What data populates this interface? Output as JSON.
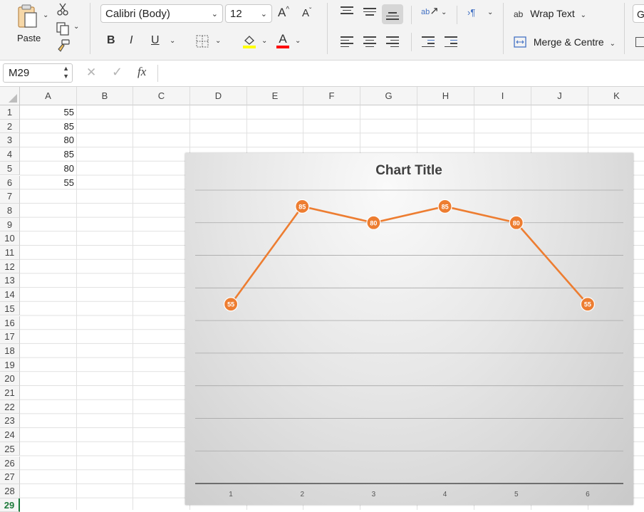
{
  "ribbon": {
    "paste_label": "Paste",
    "font_name": "Calibri (Body)",
    "font_size": "12",
    "bold": "B",
    "italic": "I",
    "underline": "U",
    "font_color_letter": "A",
    "wrap_text": "Wrap Text",
    "merge_centre": "Merge & Centre",
    "grow_font": "A",
    "shrink_font": "A",
    "wrap_icon_text": "ab",
    "cut_off_label": "G"
  },
  "formula_bar": {
    "name_box": "M29",
    "fx": "fx",
    "cancel": "✕",
    "enter": "✓",
    "formula": ""
  },
  "sheet": {
    "columns": [
      "A",
      "B",
      "C",
      "D",
      "E",
      "F",
      "G",
      "H",
      "I",
      "J",
      "K"
    ],
    "rows": [
      "1",
      "2",
      "3",
      "4",
      "5",
      "6",
      "7",
      "8",
      "9",
      "10",
      "11",
      "12",
      "13",
      "14",
      "15",
      "16",
      "17",
      "18",
      "19",
      "20",
      "21",
      "22",
      "23",
      "24",
      "25",
      "26",
      "27",
      "28",
      "29"
    ],
    "active_row": "29",
    "column_a_values": [
      "55",
      "85",
      "80",
      "85",
      "80",
      "55"
    ]
  },
  "colors": {
    "accent": "#1d7a3a",
    "series": "#ed7d31",
    "highlight_yellow": "#ffff00",
    "font_red": "#ff0000"
  },
  "chart_data": {
    "type": "line",
    "title": "Chart Title",
    "categories": [
      "1",
      "2",
      "3",
      "4",
      "5",
      "6"
    ],
    "series": [
      {
        "values": [
          55,
          85,
          80,
          85,
          80,
          55
        ]
      }
    ],
    "ylim": [
      0,
      90
    ],
    "grid": true,
    "data_labels": [
      "55",
      "85",
      "80",
      "85",
      "80",
      "55"
    ],
    "legend": "none"
  }
}
